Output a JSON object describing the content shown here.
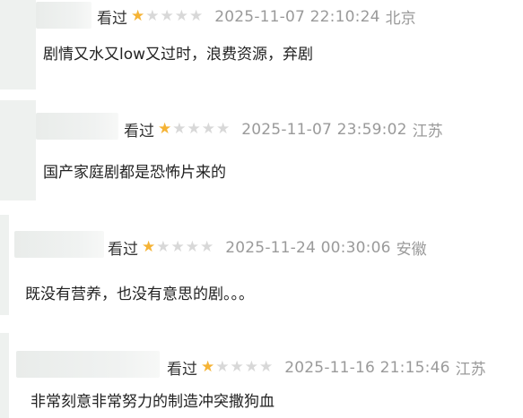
{
  "comments": [
    {
      "status": "看过",
      "rating": 1,
      "max_rating": 5,
      "time": "2025-11-07 22:10:24",
      "location": "北京",
      "text": "剧情又水又low又过时，浪费资源，弃剧"
    },
    {
      "status": "看过",
      "rating": 1,
      "max_rating": 5,
      "time": "2025-11-07 23:59:02",
      "location": "江苏",
      "text": "国产家庭剧都是恐怖片来的"
    },
    {
      "status": "看过",
      "rating": 1,
      "max_rating": 5,
      "time": "2025-11-24 00:30:06",
      "location": "安徽",
      "text": "既没有营养，也没有意思的剧。。。"
    },
    {
      "status": "看过",
      "rating": 1,
      "max_rating": 5,
      "time": "2025-11-16 21:15:46",
      "location": "江苏",
      "text": "非常刻意非常努力的制造冲突撒狗血"
    }
  ],
  "colors": {
    "star_on": "#f5b335",
    "star_off": "#d8d8d8",
    "meta_gray": "#9a9a9a"
  }
}
